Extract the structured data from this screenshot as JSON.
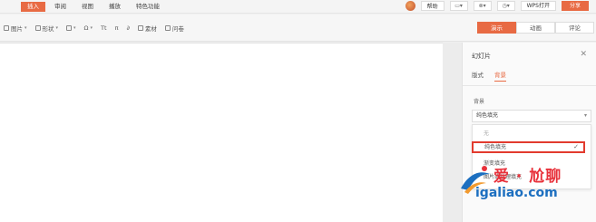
{
  "menu": {
    "tabs": [
      "插入",
      "审阅",
      "视图",
      "播放",
      "特色功能"
    ],
    "active_index": 0,
    "help_label": "帮助",
    "wps_label": "WPS打开",
    "share_label": "分享",
    "accent": "#e86a43"
  },
  "toolbar": {
    "tools": [
      "图片",
      "形状",
      "表格",
      "符号",
      "Tt",
      "公式",
      "链接",
      "素材",
      "问卷"
    ],
    "segments": [
      "演示",
      "动画",
      "评论"
    ],
    "active_segment": 0
  },
  "pane": {
    "title": "幻灯片",
    "close_icon": "close-icon",
    "tabs": [
      "版式",
      "背景"
    ],
    "active_tab": 1,
    "section_label": "背景",
    "select_value": "纯色填充",
    "dropdown": {
      "items": [
        "无",
        "纯色填充",
        "渐变填充",
        "图片或纹理填充"
      ],
      "selected_index": 1,
      "highlight_color": "#e23b2e"
    }
  },
  "watermark": {
    "cn": "爱 · 尬聊",
    "url": "igaliao.com"
  }
}
